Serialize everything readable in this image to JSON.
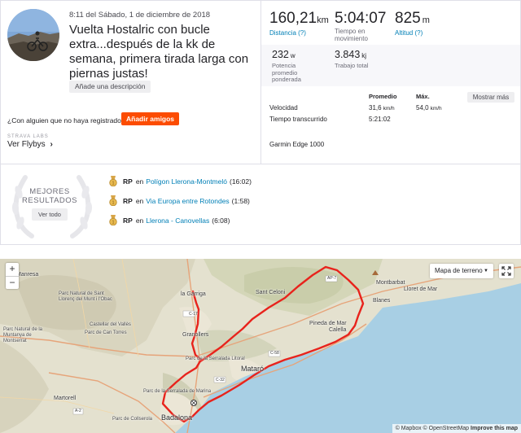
{
  "activity": {
    "date": "8:11 del Sábado, 1 de diciembre de 2018",
    "title": "Vuelta Hostalric con bucle extra...después de la kk de semana, primera tirada larga con piernas justas!",
    "add_description": "Añade una descripción",
    "registered_question": "¿Con alguien que no haya registrado?",
    "add_friends": "Añadir amigos",
    "labs_label": "STRAVA LABS",
    "flybys": "Ver Flybys",
    "flybys_chevron": "›"
  },
  "stats": {
    "distance": {
      "value": "160,21",
      "unit": "km",
      "label": "Distancia (?)"
    },
    "moving_time": {
      "value": "5:04:07",
      "label_1": "Tiempo en",
      "label_2": "movimiento"
    },
    "elevation": {
      "value": "825",
      "unit": "m",
      "label": "Altitud (?)"
    },
    "power": {
      "value": "232",
      "unit": "w",
      "label_1": "Potencia",
      "label_2": "promedio",
      "label_3": "ponderada"
    },
    "work": {
      "value": "3.843",
      "unit": "kj",
      "label": "Trabajo total"
    },
    "table": {
      "avg_header": "Promedio",
      "max_header": "Máx.",
      "show_more": "Mostrar más",
      "speed_label": "Velocidad",
      "speed_avg": "31,6",
      "speed_max": "54,0",
      "speed_unit": "km/h",
      "elapsed_label": "Tiempo transcurrido",
      "elapsed_value": "5:21:02"
    },
    "device": "Garmin Edge 1000"
  },
  "best_efforts": {
    "title_1": "MEJORES",
    "title_2": "RESULTADOS",
    "see_all": "Ver todo",
    "items": [
      {
        "badge": "RP",
        "prep": "en",
        "segment": "Polígon Llerona-Montmeló",
        "time": "(16:02)"
      },
      {
        "badge": "RP",
        "prep": "en",
        "segment": "Via Europa entre Rotondes",
        "time": "(1:58)"
      },
      {
        "badge": "RP",
        "prep": "en",
        "segment": "Llerona - Canovellas",
        "time": "(6:08)"
      }
    ]
  },
  "map": {
    "zoom_in": "+",
    "zoom_out": "−",
    "layer_select": "Mapa de terreno",
    "layer_caret": "▼",
    "attribution": "© Mapbox © OpenStreetMap",
    "improve": "Improve this map",
    "labels": {
      "manresa": "Manresa",
      "montbarbat": "Montbarbat",
      "lloret": "Lloret de Mar",
      "blanes": "Blanes",
      "sant_celoni": "Sant Celoni",
      "la_garriga": "la Garriga",
      "granollers": "Granollers",
      "pineda": "Pineda de Mar",
      "calella": "Calella",
      "mataro": "Mataró",
      "badalona": "Badalona",
      "martorell": "Martorell",
      "serralada_litoral": "Parc de la Serralada Litoral",
      "serralada_marina": "Parc de la Serralada de Marina",
      "collserola": "Parc de Collserola",
      "castellar": "Castellar del Vallès",
      "can_torres": "Parc de Can Torres",
      "montserrat": "Parc Natural de la Muntanya de Montserrat",
      "sant_llorenc": "Parc Natural de Sant Llorenç del Munt i l'Obac",
      "road_ap7": "AP-7",
      "road_c17": "C-17",
      "road_c32": "C-32",
      "road_c58": "C-58",
      "road_a2": "A-2"
    }
  }
}
